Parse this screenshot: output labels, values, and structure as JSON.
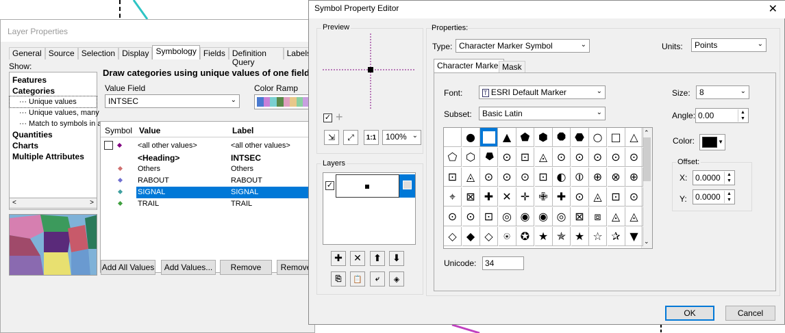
{
  "layer_properties": {
    "title": "Layer Properties",
    "tabs": [
      "General",
      "Source",
      "Selection",
      "Display",
      "Symbology",
      "Fields",
      "Definition Query",
      "Labels"
    ],
    "active_tab": "Symbology",
    "show_label": "Show:",
    "tree": [
      "Features",
      "Categories",
      "Unique values",
      "Unique values, many",
      "Match to symbols in a",
      "Quantities",
      "Charts",
      "Multiple Attributes"
    ],
    "description": "Draw categories using unique values of one field.",
    "value_field_label": "Value Field",
    "value_field": "INTSEC",
    "color_ramp_label": "Color Ramp",
    "columns": {
      "symbol": "Symbol",
      "value": "Value",
      "label": "Label"
    },
    "rows": [
      {
        "value": "<all other values>",
        "label": "<all other values>",
        "bold": false,
        "selected": false
      },
      {
        "value": "<Heading>",
        "label": "INTSEC",
        "bold": true,
        "selected": false
      },
      {
        "value": "Others",
        "label": "Others",
        "bold": false,
        "selected": false
      },
      {
        "value": "RABOUT",
        "label": "RABOUT",
        "bold": false,
        "selected": false
      },
      {
        "value": "SIGNAL",
        "label": "SIGNAL",
        "bold": false,
        "selected": true
      },
      {
        "value": "TRAIL",
        "label": "TRAIL",
        "bold": false,
        "selected": false
      }
    ],
    "buttons": {
      "add_all": "Add All Values",
      "add_values": "Add Values...",
      "remove": "Remove",
      "remove2": "Remove"
    }
  },
  "symbol_editor": {
    "title": "Symbol Property Editor",
    "preview_label": "Preview",
    "zoom": "100%",
    "layers_label": "Layers",
    "properties_label": "Properties:",
    "type_label": "Type:",
    "type_value": "Character Marker Symbol",
    "units_label": "Units:",
    "units_value": "Points",
    "tabs": [
      "Character Marker",
      "Mask"
    ],
    "font_label": "Font:",
    "font_value": "ESRI Default Marker",
    "subset_label": "Subset:",
    "subset_value": "Basic Latin",
    "size_label": "Size:",
    "size_value": "8",
    "angle_label": "Angle:",
    "angle_value": "0.00",
    "color_label": "Color:",
    "offset_label": "Offset:",
    "x_label": "X:",
    "x_value": "0.0000",
    "y_label": "Y:",
    "y_value": "0.0000",
    "unicode_label": "Unicode:",
    "unicode_value": "34",
    "ok": "OK",
    "cancel": "Cancel",
    "glyphs": [
      [
        "",
        "●",
        "■",
        "▲",
        "⬟",
        "⬢",
        "⯃",
        "⬣",
        "○",
        "□",
        "△"
      ],
      [
        "⬠",
        "⬡",
        "⯂",
        "⊙",
        "⊡",
        "◬",
        "⊙",
        "⊙",
        "⊙",
        "⊙",
        "⊙"
      ],
      [
        "⊡",
        "◬",
        "⊙",
        "⊙",
        "⊙",
        "⊡",
        "◐",
        "⦶",
        "⊕",
        "⊗",
        "⊕"
      ],
      [
        "⌖",
        "⊠",
        "✚",
        "✕",
        "✛",
        "✙",
        "✚",
        "⊙",
        "◬",
        "⊡",
        "⊙"
      ],
      [
        "⊙",
        "⊙",
        "⊡",
        "◎",
        "◉",
        "◉",
        "◎",
        "⊠",
        "⧈",
        "◬",
        "◬"
      ],
      [
        "◇",
        "◆",
        "◇",
        "⍟",
        "✪",
        "★",
        "✯",
        "★",
        "☆",
        "✰",
        "▼"
      ]
    ],
    "selected_glyph": [
      0,
      2
    ]
  },
  "colors": {
    "selection": "#0078d7",
    "swatch": "#000000"
  }
}
